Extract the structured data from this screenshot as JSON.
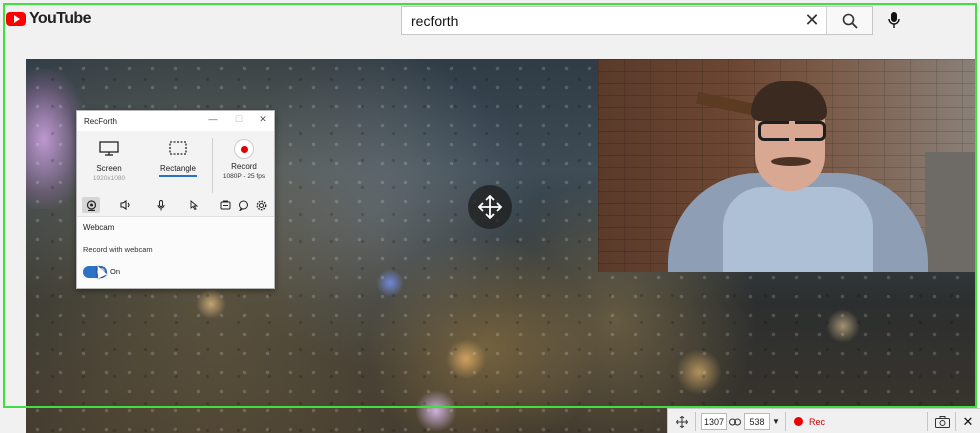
{
  "youtube": {
    "logo_text": "YouTube",
    "search_value": "recforth",
    "search_placeholder": "Search"
  },
  "recforth_window": {
    "title": "RecForth",
    "modes": [
      {
        "label": "Screen",
        "sub": "1920x1080",
        "icon": "monitor-icon"
      },
      {
        "label": "Rectangle",
        "sub": "",
        "icon": "rectangle-select-icon"
      },
      {
        "label": "Record",
        "sub": "1080P - 25 fps",
        "icon": "record-icon"
      }
    ],
    "tabs": [
      "webcam-icon",
      "speaker-icon",
      "microphone-icon",
      "cursor-icon",
      "screenshot-icon",
      "comment-icon",
      "settings-icon"
    ],
    "panel": {
      "title": "Webcam",
      "option": "Record with webcam",
      "toggle_label": "On",
      "toggle_on": true
    }
  },
  "toolbar": {
    "width": "1307",
    "height": "538",
    "rec_label": "Rec"
  },
  "colors": {
    "capture_frame": "#3fe03f",
    "accent_blue": "#2673c7",
    "record_red": "#e00000"
  }
}
